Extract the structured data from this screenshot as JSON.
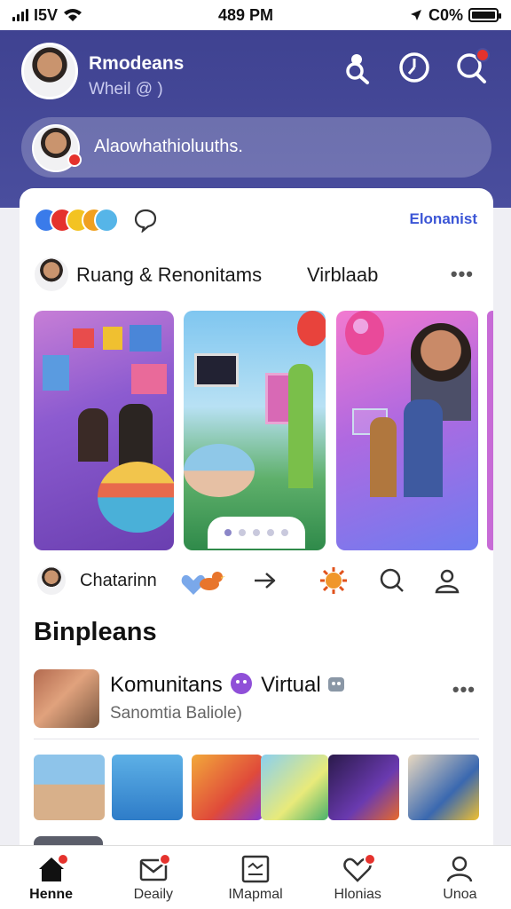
{
  "status_bar": {
    "carrier": "I5V",
    "time": "489 PM",
    "battery": "C0%"
  },
  "header": {
    "name": "Rmodeans",
    "handle": "Wheil @ )",
    "composer_text": "Alaowhathioluuths."
  },
  "feed_card": {
    "link": "Elonanist",
    "post": {
      "title": "Ruang & Renonitams",
      "tag": "Virblaab"
    },
    "gallery_slides": 3,
    "gallery_active_dot": 0,
    "chat_label": "Chatarinn"
  },
  "section": {
    "title": "Binpleans",
    "item": {
      "title": "Komunitans",
      "title_tag": "Virtual",
      "subtitle": "Sanomtia Baliole)"
    },
    "thumbnails": 6
  },
  "tabs": [
    {
      "label": "Henne",
      "active": true,
      "badge": true
    },
    {
      "label": "Deaily",
      "active": false,
      "badge": true
    },
    {
      "label": "IMapmal",
      "active": false,
      "badge": false
    },
    {
      "label": "Hlonias",
      "active": false,
      "badge": true
    },
    {
      "label": "Unoa",
      "active": false,
      "badge": false
    }
  ],
  "colors": {
    "header": "#434795",
    "accent": "#3c56d6",
    "badge": "#e5322d"
  }
}
